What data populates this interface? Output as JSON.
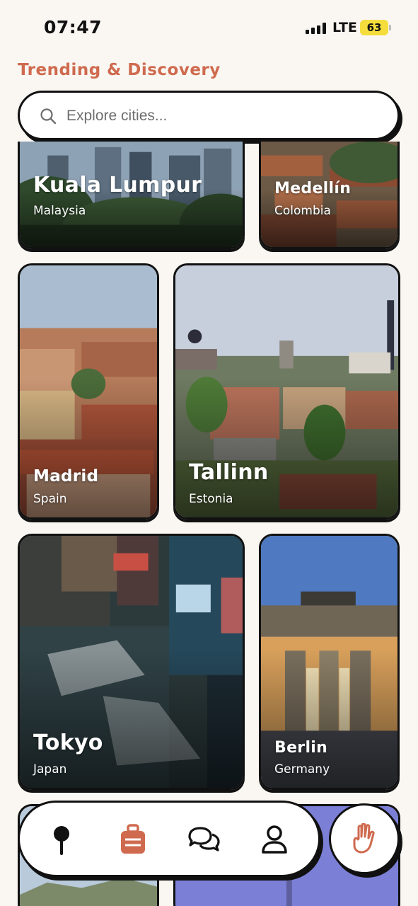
{
  "status_bar": {
    "time": "07:47",
    "network": "LTE",
    "battery": "63"
  },
  "header": {
    "title": "Trending & Discovery"
  },
  "search": {
    "placeholder": "Explore cities..."
  },
  "cities": [
    {
      "city": "Kuala Lumpur",
      "country": "Malaysia"
    },
    {
      "city": "Medellín",
      "country": "Colombia"
    },
    {
      "city": "Madrid",
      "country": "Spain"
    },
    {
      "city": "Tallinn",
      "country": "Estonia"
    },
    {
      "city": "Tokyo",
      "country": "Japan"
    },
    {
      "city": "Berlin",
      "country": "Germany"
    }
  ],
  "nav": {
    "items": [
      {
        "icon": "map-pin-icon",
        "active": false
      },
      {
        "icon": "suitcase-icon",
        "active": true
      },
      {
        "icon": "chat-bubbles-icon",
        "active": false
      },
      {
        "icon": "profile-icon",
        "active": false
      }
    ],
    "action_icon": "hand-wave-icon"
  },
  "colors": {
    "accent": "#cf6a4f",
    "ink": "#111111",
    "background": "#faf7f2",
    "battery": "#f4dd3d"
  }
}
